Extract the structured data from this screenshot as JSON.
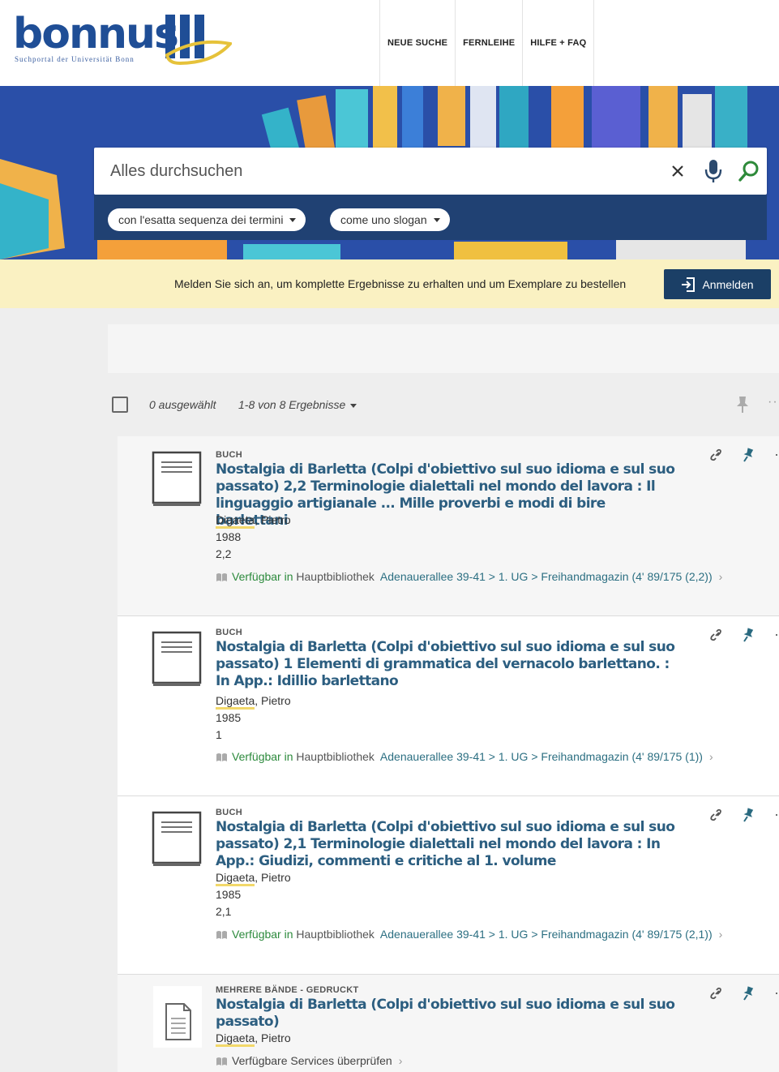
{
  "header": {
    "logo_text": "bonnus",
    "logo_subtitle": "Suchportal der Universität Bonn",
    "nav": [
      "NEUE SUCHE",
      "FERNLEIHE",
      "HILFE + FAQ"
    ]
  },
  "search": {
    "placeholder": "Alles durchsuchen",
    "chips": [
      "con l'esatta sequenza dei termini",
      "come uno slogan"
    ]
  },
  "login": {
    "message": "Melden Sie sich an, um komplette Ergebnisse zu erhalten und um Exemplare zu bestellen",
    "button": "Anmelden"
  },
  "toolbar": {
    "selected": "0 ausgewählt",
    "range": "1-8 von 8 Ergebnisse"
  },
  "colors": {
    "accent": "#1b3f66",
    "title": "#2c5e80",
    "available": "#2c8a3c",
    "banner": "#2a4fa8",
    "login_bg": "#faf1c2"
  },
  "results": [
    {
      "type": "BUCH",
      "title": "Nostalgia di Barletta (Colpi d'obiettivo sul suo idioma e sul suo passato) 2,2 Terminologie dialettali nel mondo del lavora : Il linguaggio artigianale ... Mille proverbi e modi di bire barlettani",
      "author_last": "Digaeta",
      "author_rest": ", Pietro",
      "year": "1988",
      "volume": "2,2",
      "avail_status": "Verfügbar in",
      "avail_library": "Hauptbibliothek",
      "avail_location": "Adenauerallee 39-41 > 1. UG > Freihandmagazin (4' 89/175 (2,2))"
    },
    {
      "type": "BUCH",
      "title": "Nostalgia di Barletta (Colpi d'obiettivo sul suo idioma e sul suo passato) 1 Elementi di grammatica del vernacolo barlettano. : In App.: Idillio barlettano",
      "author_last": "Digaeta",
      "author_rest": ", Pietro",
      "year": "1985",
      "volume": "1",
      "avail_status": "Verfügbar in",
      "avail_library": "Hauptbibliothek",
      "avail_location": "Adenauerallee 39-41 > 1. UG > Freihandmagazin (4' 89/175 (1))"
    },
    {
      "type": "BUCH",
      "title": "Nostalgia di Barletta (Colpi d'obiettivo sul suo idioma e sul suo passato) 2,1 Terminologie dialettali nel mondo del lavora : In App.: Giudizi, commenti e critiche al 1. volume",
      "author_last": "Digaeta",
      "author_rest": ", Pietro",
      "year": "1985",
      "volume": "2,1",
      "avail_status": "Verfügbar in",
      "avail_library": "Hauptbibliothek",
      "avail_location": "Adenauerallee 39-41 > 1. UG > Freihandmagazin (4' 89/175 (2,1))"
    },
    {
      "type": "MEHRERE BÄNDE - GEDRUCKT",
      "title": "Nostalgia di Barletta (Colpi d'obiettivo sul suo idioma e sul suo passato)",
      "author_last": "Digaeta",
      "author_rest": ", Pietro",
      "services": "Verfügbare Services überprüfen"
    }
  ]
}
